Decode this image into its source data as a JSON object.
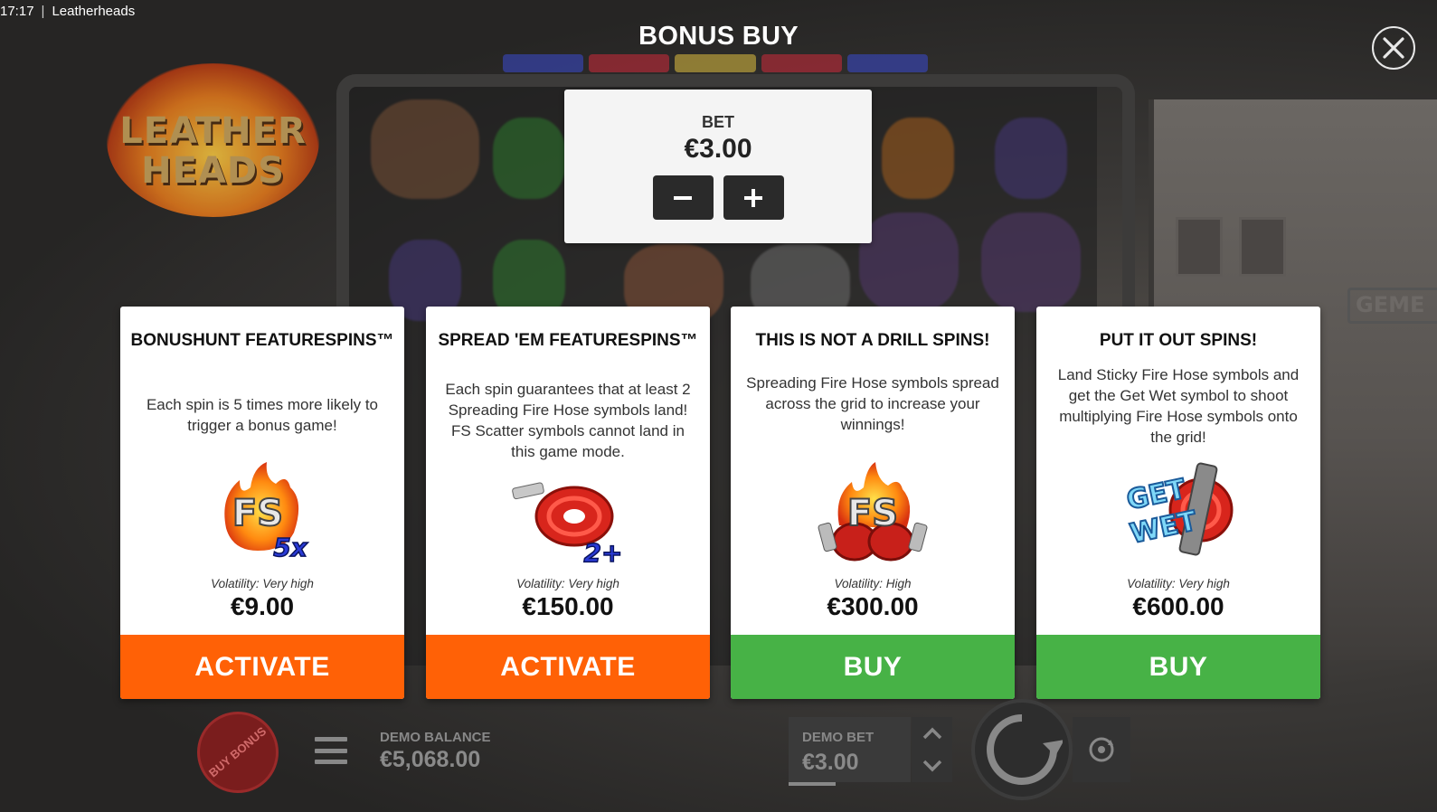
{
  "status_bar": {
    "time": "17:17",
    "separator": "|",
    "app_name": "Leatherheads"
  },
  "game_logo": {
    "line1": "LEATHER",
    "line2": "HEADS"
  },
  "background_sign": "GEME",
  "overlay": {
    "title": "BONUS BUY",
    "close_icon": "close-icon"
  },
  "bet_panel": {
    "label": "BET",
    "value": "€3.00",
    "decrease_icon": "minus-icon",
    "increase_icon": "plus-icon"
  },
  "cards": [
    {
      "title": "BONUSHUNT FEATURESPINS™",
      "description": "Each spin is 5 times more likely to trigger a bonus game!",
      "icon": "fs-5x-icon",
      "volatility": "Volatility: Very high",
      "price": "€9.00",
      "action": "ACTIVATE",
      "action_color": "#ff6106"
    },
    {
      "title": "SPREAD 'EM FEATURESPINS™",
      "description": "Each spin guarantees that at least 2 Spreading Fire Hose symbols land! FS Scatter symbols cannot land in this game mode.",
      "icon": "fire-hose-2plus-icon",
      "volatility": "Volatility: Very high",
      "price": "€150.00",
      "action": "ACTIVATE",
      "action_color": "#ff6106"
    },
    {
      "title": "THIS IS NOT A DRILL SPINS!",
      "description": "Spreading Fire Hose symbols spread across the grid to increase your winnings!",
      "icon": "fs-fire-hose-icon",
      "volatility": "Volatility: High",
      "price": "€300.00",
      "action": "BUY",
      "action_color": "#47b246"
    },
    {
      "title": "PUT IT OUT SPINS!",
      "description": "Land Sticky Fire Hose symbols and get the Get Wet symbol to shoot multiplying Fire Hose symbols onto the grid!",
      "icon": "get-wet-icon",
      "volatility": "Volatility: Very high",
      "price": "€600.00",
      "action": "BUY",
      "action_color": "#47b246"
    }
  ],
  "bottom_bar": {
    "buy_bonus_label": "BUY BONUS",
    "menu_icon": "hamburger-menu-icon",
    "balance_label": "DEMO BALANCE",
    "balance_value": "€5,068.00",
    "bet_label": "DEMO BET",
    "bet_value": "€3.00",
    "bet_up_icon": "chevron-up-icon",
    "bet_down_icon": "chevron-down-icon",
    "spin_icon": "spin-icon",
    "autoplay_icon": "autoplay-icon"
  }
}
